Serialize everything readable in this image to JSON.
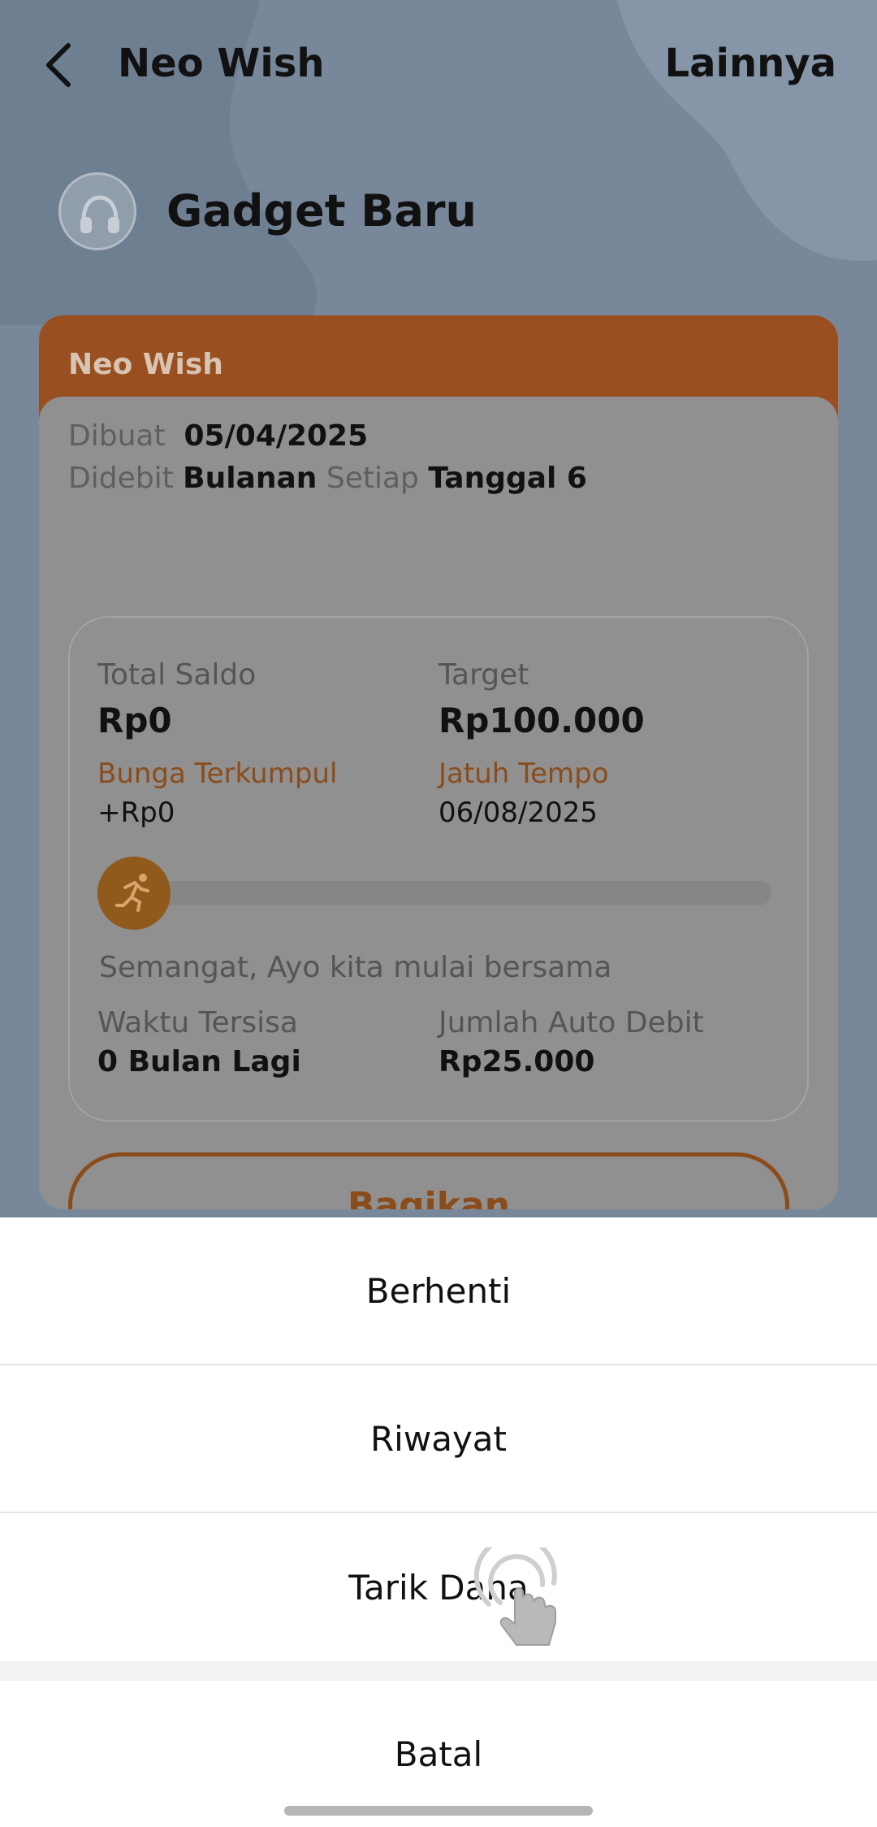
{
  "header": {
    "title": "Neo Wish",
    "more_label": "Lainnya"
  },
  "goal": {
    "icon": "headphones-icon",
    "title": "Gadget Baru"
  },
  "card": {
    "product_label": "Neo Wish",
    "created_label": "Dibuat",
    "created_date": "05/04/2025",
    "debit_label": "Didebit",
    "debit_frequency": "Bulanan",
    "every_label": "Setiap",
    "debit_day": "Tanggal 6",
    "total_balance_label": "Total Saldo",
    "total_balance": "Rp0",
    "target_label": "Target",
    "target": "Rp100.000",
    "interest_label": "Bunga Terkumpul",
    "interest": "+Rp0",
    "due_label": "Jatuh Tempo",
    "due_date": "06/08/2025",
    "progress_fraction": 0.0,
    "motto": "Semangat, Ayo kita mulai bersama",
    "time_left_label": "Waktu Tersisa",
    "time_left": "0 Bulan Lagi",
    "auto_debit_label": "Jumlah Auto Debit",
    "auto_debit": "Rp25.000",
    "share_label": "Bagikan"
  },
  "sheet": {
    "stop_label": "Berhenti",
    "history_label": "Riwayat",
    "withdraw_label": "Tarik Dana",
    "cancel_label": "Batal"
  },
  "colors": {
    "accent": "#E07A1F",
    "overlay": "#000000"
  }
}
